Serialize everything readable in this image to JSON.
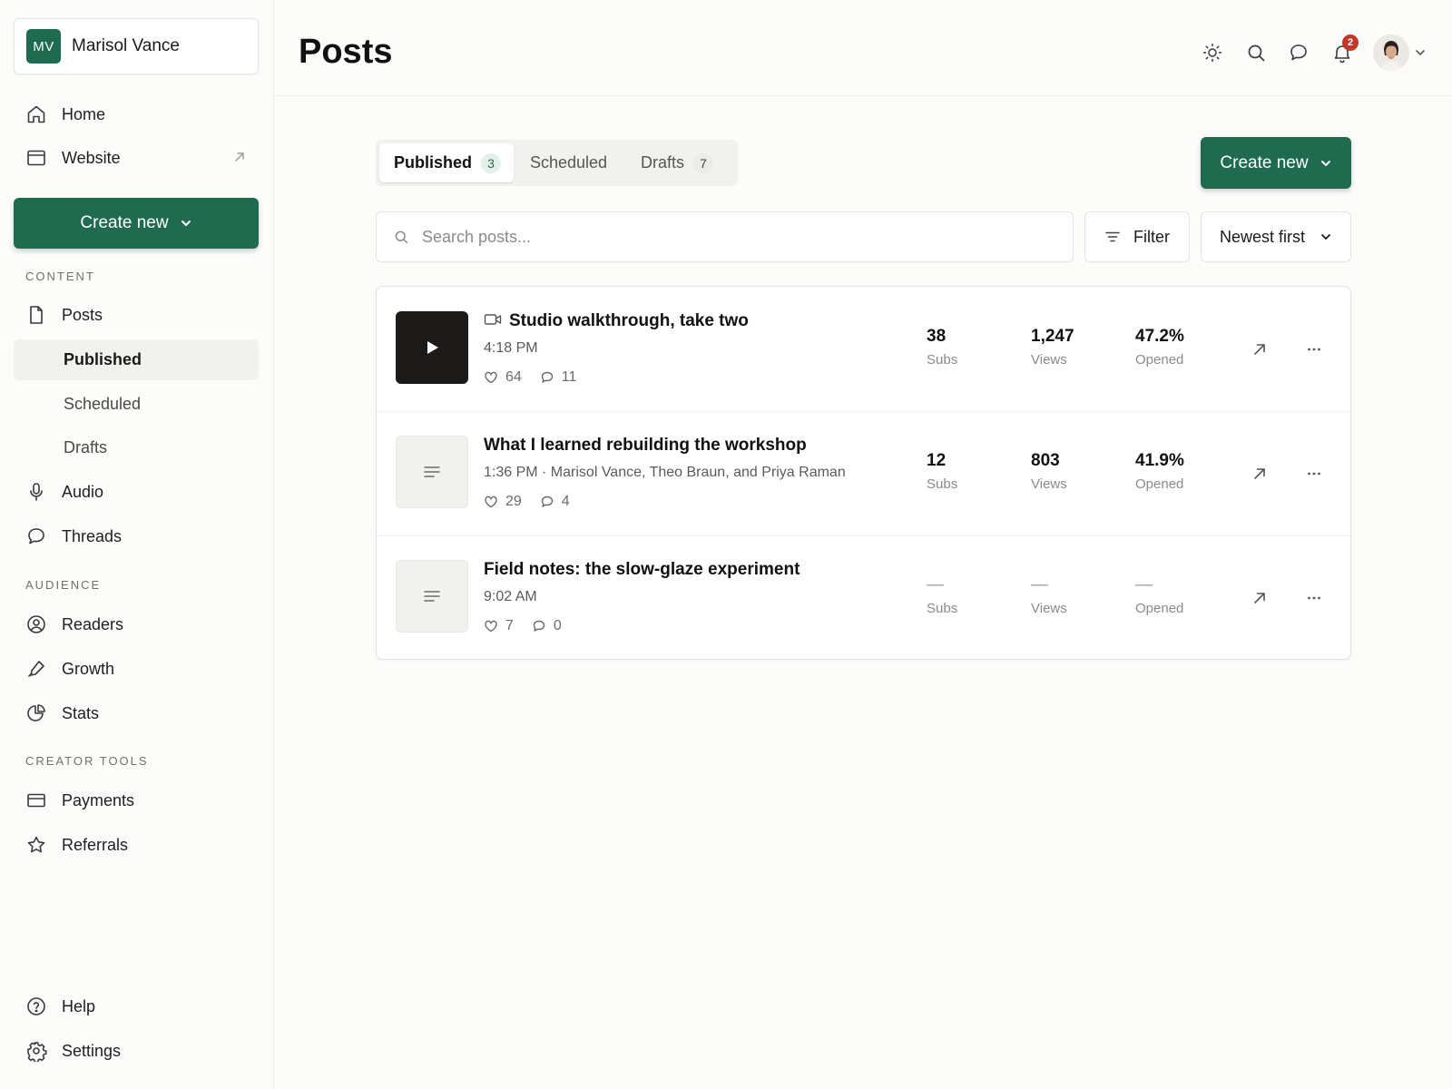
{
  "account": {
    "initials": "MV",
    "name": "Marisol Vance"
  },
  "nav_top": [
    {
      "label": "Home",
      "icon": "home-icon"
    },
    {
      "label": "Website",
      "icon": "browser-window-icon"
    }
  ],
  "sidebar_create": {
    "label": "Create new"
  },
  "sections": {
    "content": "CONTENT",
    "audience": "AUDIENCE",
    "creator_tools": "CREATOR TOOLS"
  },
  "content_nav": {
    "posts": "Posts",
    "published": "Published",
    "scheduled": "Scheduled",
    "drafts": "Drafts",
    "audio": "Audio",
    "threads": "Threads"
  },
  "audience_nav": {
    "readers": "Readers",
    "growth": "Growth",
    "stats": "Stats"
  },
  "tools_nav": {
    "payments": "Payments",
    "referrals": "Referrals"
  },
  "footer_nav": {
    "help": "Help",
    "settings": "Settings"
  },
  "header": {
    "title": "Posts",
    "notification_count": "2"
  },
  "tabs": [
    {
      "label": "Published",
      "count": "3",
      "active": true
    },
    {
      "label": "Scheduled",
      "count": "",
      "active": false
    },
    {
      "label": "Drafts",
      "count": "7",
      "active": false
    }
  ],
  "main_create": {
    "label": "Create new"
  },
  "search": {
    "placeholder": "Search posts...",
    "value": ""
  },
  "filter": {
    "label": "Filter"
  },
  "sort": {
    "label": "Newest first"
  },
  "colors": {
    "accent": "#1f6b4f",
    "badge": "#c0392b"
  },
  "posts": [
    {
      "type": "video",
      "title": "Studio walkthrough, take two",
      "meta": "4:18 PM",
      "likes": "64",
      "comments": "11",
      "subs": "38",
      "views": "1,247",
      "opened": "47.2%",
      "labels": {
        "subs": "Subs",
        "views": "Views",
        "opened": "Opened"
      }
    },
    {
      "type": "text",
      "title": "What I learned rebuilding the workshop",
      "meta": "1:36 PM · Marisol Vance, Theo Braun, and Priya Raman",
      "likes": "29",
      "comments": "4",
      "subs": "12",
      "views": "803",
      "opened": "41.9%",
      "labels": {
        "subs": "Subs",
        "views": "Views",
        "opened": "Opened"
      }
    },
    {
      "type": "text",
      "title": "Field notes: the slow-glaze experiment",
      "meta": "9:02 AM",
      "likes": "7",
      "comments": "0",
      "subs": "—",
      "views": "—",
      "opened": "—",
      "labels": {
        "subs": "Subs",
        "views": "Views",
        "opened": "Opened"
      }
    }
  ]
}
